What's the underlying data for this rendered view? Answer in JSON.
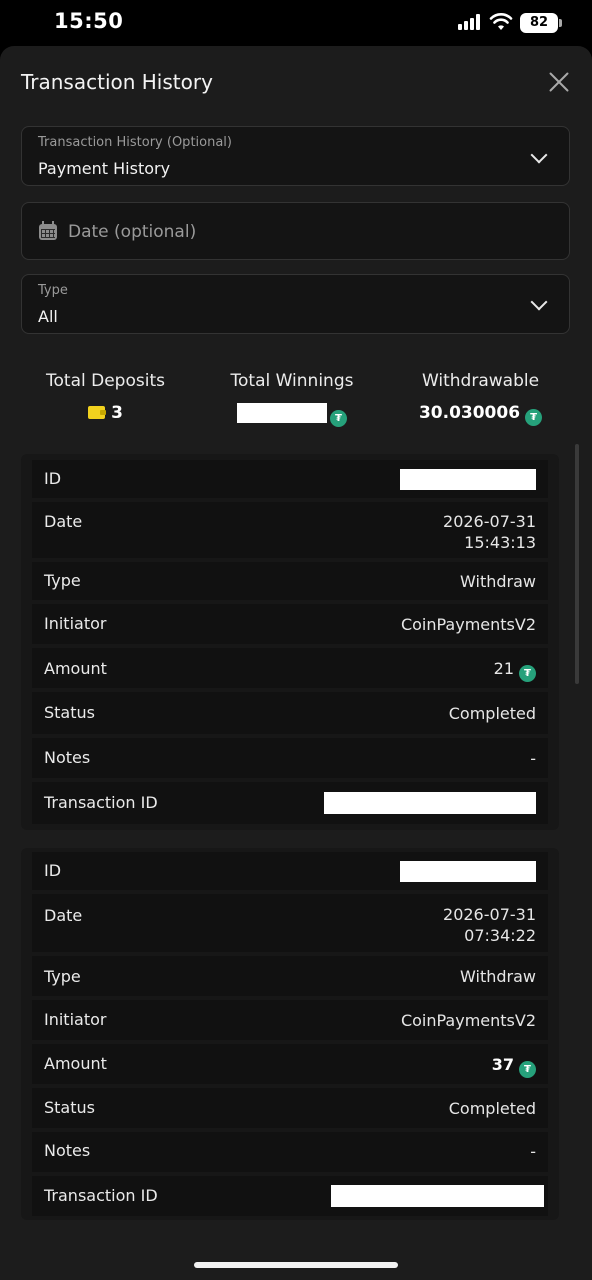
{
  "status_bar": {
    "time": "15:50",
    "battery": "82"
  },
  "header": {
    "title": "Transaction History"
  },
  "filters": {
    "history": {
      "label": "Transaction History (Optional)",
      "value": "Payment History"
    },
    "date": {
      "placeholder": "Date (optional)"
    },
    "type": {
      "label": "Type",
      "value": "All"
    }
  },
  "stats": [
    {
      "label": "Total Deposits",
      "value": "3",
      "icon": "wallet-icon"
    },
    {
      "label": "Total Winnings",
      "value": "",
      "icon": "tether-icon",
      "redacted": true
    },
    {
      "label": "Withdrawable",
      "value": "30.030006",
      "icon": "tether-icon"
    }
  ],
  "transactions": [
    {
      "rows": [
        {
          "label": "ID",
          "value": "",
          "redacted": true
        },
        {
          "label": "Date",
          "value": "2026-07-31",
          "value2": "15:43:13"
        },
        {
          "label": "Type",
          "value": "Withdraw"
        },
        {
          "label": "Initiator",
          "value": "CoinPaymentsV2"
        },
        {
          "label": "Amount",
          "value": "21",
          "icon": "tether-icon"
        },
        {
          "label": "Status",
          "value": "Completed"
        },
        {
          "label": "Notes",
          "value": "-"
        },
        {
          "label": "Transaction ID",
          "value": "",
          "redacted": true
        }
      ]
    },
    {
      "rows": [
        {
          "label": "ID",
          "value": "",
          "redacted": true
        },
        {
          "label": "Date",
          "value": "2026-07-31",
          "value2": "07:34:22"
        },
        {
          "label": "Type",
          "value": "Withdraw"
        },
        {
          "label": "Initiator",
          "value": "CoinPaymentsV2"
        },
        {
          "label": "Amount",
          "value": "37",
          "icon": "tether-icon"
        },
        {
          "label": "Status",
          "value": "Completed"
        },
        {
          "label": "Notes",
          "value": "-"
        },
        {
          "label": "Transaction ID",
          "value": "",
          "redacted": true
        }
      ]
    }
  ],
  "colors": {
    "background": "#1c1c1c",
    "tether": "#26a17b",
    "wallet": "#f2d21e"
  }
}
